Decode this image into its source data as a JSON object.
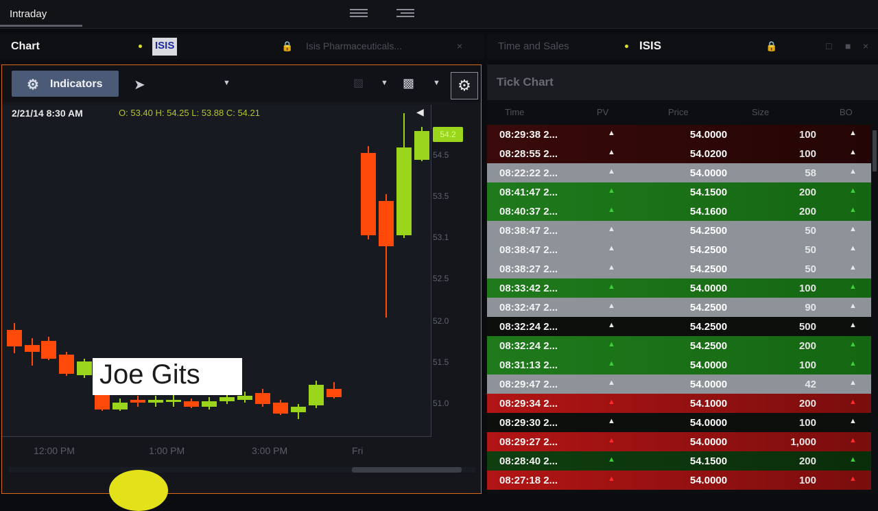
{
  "topbar": {
    "title": "Intraday"
  },
  "chart_header": {
    "label": "Chart",
    "symbol": "ISIS",
    "company": "Isis Pharmaceuticals..."
  },
  "tas_header": {
    "label": "Time and Sales",
    "symbol": "ISIS"
  },
  "chart": {
    "indicators_label": "Indicators",
    "datetime": "2/21/14  8:30 AM",
    "ohlc": "O: 53.40  H: 54.25  L: 53.88  C: 54.21",
    "current_price": "54.2",
    "price_ticks": [
      "54.5",
      "53.5",
      "53.1",
      "52.5",
      "52.0",
      "51.5",
      "51.0"
    ],
    "time_ticks": [
      "12:00 PM",
      "1:00 PM",
      "3:00 PM",
      "Fri"
    ],
    "watermark": "Joe Gits"
  },
  "tick_chart": {
    "title": "Tick Chart",
    "columns": [
      "Time",
      "PV",
      "Price",
      "Size",
      "BO"
    ],
    "rows": [
      {
        "time": "08:29:38 2...",
        "price": "54.0000",
        "size": "100",
        "style": "dark-red"
      },
      {
        "time": "08:28:55 2...",
        "price": "54.0200",
        "size": "100",
        "style": "dark-red"
      },
      {
        "time": "08:22:22 2...",
        "price": "54.0000",
        "size": "58",
        "style": "gray"
      },
      {
        "time": "08:41:47 2...",
        "price": "54.1500",
        "size": "200",
        "style": "green"
      },
      {
        "time": "08:40:37 2...",
        "price": "54.1600",
        "size": "200",
        "style": "green"
      },
      {
        "time": "08:38:47 2...",
        "price": "54.2500",
        "size": "50",
        "style": "gray"
      },
      {
        "time": "08:38:47 2...",
        "price": "54.2500",
        "size": "50",
        "style": "gray"
      },
      {
        "time": "08:38:27 2...",
        "price": "54.2500",
        "size": "50",
        "style": "gray"
      },
      {
        "time": "08:33:42 2...",
        "price": "54.0000",
        "size": "100",
        "style": "green"
      },
      {
        "time": "08:32:47 2...",
        "price": "54.2500",
        "size": "90",
        "style": "gray"
      },
      {
        "time": "08:32:24 2...",
        "price": "54.2500",
        "size": "500",
        "style": "black"
      },
      {
        "time": "08:32:24 2...",
        "price": "54.2500",
        "size": "200",
        "style": "green"
      },
      {
        "time": "08:31:13 2...",
        "price": "54.0000",
        "size": "100",
        "style": "green"
      },
      {
        "time": "08:29:47 2...",
        "price": "54.0000",
        "size": "42",
        "style": "gray"
      },
      {
        "time": "08:29:34 2...",
        "price": "54.1000",
        "size": "200",
        "style": "red"
      },
      {
        "time": "08:29:30 2...",
        "price": "54.0000",
        "size": "100",
        "style": "black"
      },
      {
        "time": "08:29:27 2...",
        "price": "54.0000",
        "size": "1,000",
        "style": "red"
      },
      {
        "time": "08:28:40 2...",
        "price": "54.1500",
        "size": "200",
        "style": "green-dark"
      },
      {
        "time": "08:27:18 2...",
        "price": "54.0000",
        "size": "100",
        "style": "red"
      }
    ]
  },
  "colors": {
    "accent_border": "#d86a1a",
    "up": "#9bd51c",
    "down": "#ff4a0a"
  }
}
